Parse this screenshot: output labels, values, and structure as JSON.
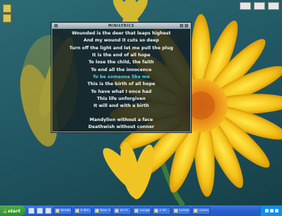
{
  "window": {
    "title": "MINILYRICS",
    "lyrics": [
      {
        "text": "Wounded is the deer that leaps highest",
        "current": false
      },
      {
        "text": "And my wound it cuts so deep",
        "current": false
      },
      {
        "text": "Turn off the light and let me pull the plug",
        "current": false
      },
      {
        "text": "It is the end of all hope",
        "current": false
      },
      {
        "text": "To lose the child, the faith",
        "current": false
      },
      {
        "text": "To end all the innocence",
        "current": false
      },
      {
        "text": "To be someone like me",
        "current": true
      },
      {
        "text": "This is the birth of all hope",
        "current": false
      },
      {
        "text": "To have what I once had",
        "current": false
      },
      {
        "text": "This life unforgiven",
        "current": false
      },
      {
        "text": "It will end with a birth",
        "current": false
      },
      {
        "text": "",
        "current": false
      },
      {
        "text": "Mandylion without a face",
        "current": false
      },
      {
        "text": "Deathwish without conner",
        "current": false
      }
    ]
  },
  "taskbar": {
    "start_label": "start",
    "tasks": [
      {
        "label": "Windo...",
        "icon": "folder-icon"
      },
      {
        "label": "4 Win...",
        "icon": "window-icon"
      },
      {
        "label": "New Ta...",
        "icon": "window-icon"
      },
      {
        "label": "16 Pi...",
        "icon": "window-icon"
      },
      {
        "label": "Google...",
        "icon": "browser-icon"
      },
      {
        "label": "2 Wi...",
        "icon": "window-icon"
      },
      {
        "label": "Eleven...",
        "icon": "media-icon"
      },
      {
        "label": "iTunes",
        "icon": "itunes-icon"
      }
    ]
  }
}
